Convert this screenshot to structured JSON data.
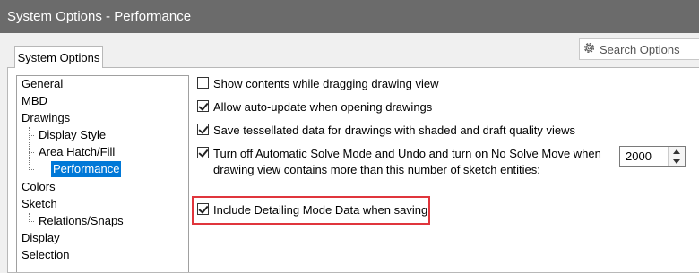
{
  "window": {
    "title": "System Options - Performance"
  },
  "search": {
    "label": "Search Options",
    "icon": "gear-icon"
  },
  "tabs": [
    {
      "label": "System Options",
      "active": true
    }
  ],
  "tree": {
    "items": [
      {
        "label": "General"
      },
      {
        "label": "MBD"
      },
      {
        "label": "Drawings"
      },
      {
        "label": "Display Style"
      },
      {
        "label": "Area Hatch/Fill"
      },
      {
        "label": "Performance",
        "selected": true
      },
      {
        "label": "Colors"
      },
      {
        "label": "Sketch"
      },
      {
        "label": "Relations/Snaps"
      },
      {
        "label": "Display"
      },
      {
        "label": "Selection"
      }
    ]
  },
  "options": [
    {
      "label": "Show contents while dragging drawing view",
      "checked": false
    },
    {
      "label": "Allow auto-update when opening drawings",
      "checked": true
    },
    {
      "label": "Save tessellated data for drawings with shaded and draft quality views",
      "checked": true
    },
    {
      "label_line1": "Turn off Automatic Solve Mode and Undo and turn on No Solve Move when",
      "label_line2": "drawing view contains more than this number of sketch entities:",
      "checked": true
    },
    {
      "label": "Include Detailing Mode Data when saving",
      "checked": true,
      "highlighted": true
    }
  ],
  "entities_spinner": {
    "value": "2000"
  },
  "colors": {
    "titlebar": "#6b6b6b",
    "selection": "#0078d7",
    "highlight": "#e0353c"
  }
}
